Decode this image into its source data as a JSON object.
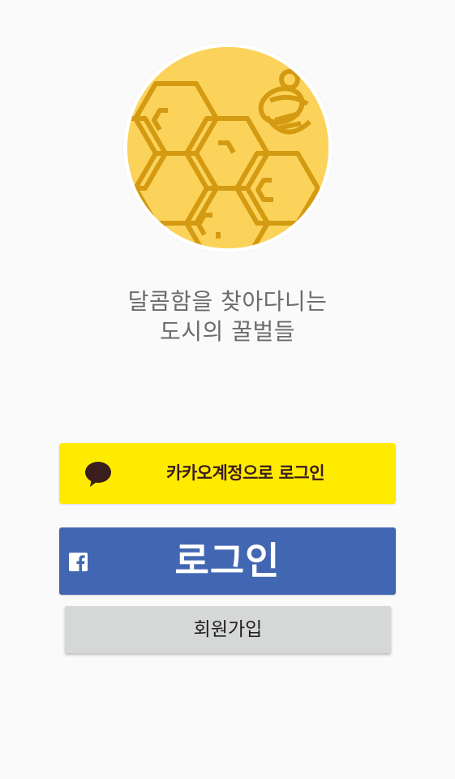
{
  "app": {
    "logo_icon": "honeycomb-bee-logo",
    "tagline_line1": "달콤함을 찾아다니는",
    "tagline_line2": "도시의 꿀벌들"
  },
  "kakao_login": {
    "label": "카카오계정으로 로그인",
    "icon": "kakao-speech-bubble-icon",
    "background": "#ffeb00",
    "text_color": "#3a1d1d"
  },
  "facebook_login": {
    "label": "로그인",
    "icon": "facebook-f-icon",
    "background": "#4267b2"
  },
  "signup": {
    "label": "회원가입",
    "background": "#d6d7d7"
  }
}
